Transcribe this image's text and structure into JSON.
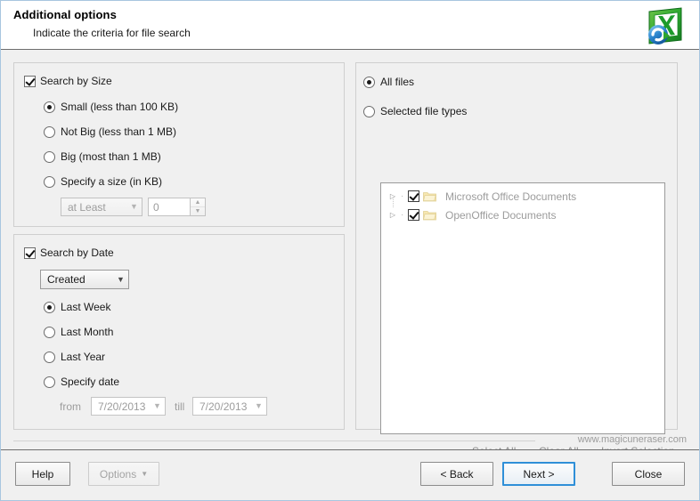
{
  "header": {
    "title": "Additional options",
    "subtitle": "Indicate the criteria for file search",
    "logo_icon": "excel-document-recovery-icon"
  },
  "size_group": {
    "checkbox_label": "Search by Size",
    "checked": true,
    "options": [
      {
        "label": "Small (less than 100 KB)",
        "selected": true
      },
      {
        "label": "Not Big (less than 1 MB)",
        "selected": false
      },
      {
        "label": "Big (most than 1 MB)",
        "selected": false
      },
      {
        "label": "Specify a size (in KB)",
        "selected": false
      }
    ],
    "comparison_value": "at Least",
    "size_value": "0"
  },
  "date_group": {
    "checkbox_label": "Search by Date",
    "checked": true,
    "date_type_value": "Created",
    "options": [
      {
        "label": "Last Week",
        "selected": true
      },
      {
        "label": "Last Month",
        "selected": false
      },
      {
        "label": "Last Year",
        "selected": false
      },
      {
        "label": "Specify date",
        "selected": false
      }
    ],
    "from_label": "from",
    "from_value": "7/20/2013",
    "till_label": "till",
    "till_value": "7/20/2013"
  },
  "types_group": {
    "all_files_label": "All files",
    "all_files_selected": true,
    "selected_types_label": "Selected file types",
    "selected_types_selected": false,
    "tree_items": [
      {
        "label": "Microsoft Office Documents",
        "checked": true,
        "expander": "▷"
      },
      {
        "label": "OpenOffice Documents",
        "checked": true,
        "expander": "▷"
      }
    ],
    "links": [
      {
        "label": "Select All"
      },
      {
        "label": "Clear All"
      },
      {
        "label": "Invert Selection"
      }
    ]
  },
  "watermark": "www.magicuneraser.com",
  "footer": {
    "help_label": "Help",
    "options_label": "Options",
    "options_caret": "▼",
    "back_label": "< Back",
    "next_label": "Next >",
    "close_label": "Close"
  },
  "colors": {
    "window_border": "#a8c6df",
    "body_background": "#f0f0f0",
    "default_button_focus": "#2f8fd8",
    "disabled_text": "#9c9c9c",
    "folder_yellow": "#f5e3a8"
  }
}
